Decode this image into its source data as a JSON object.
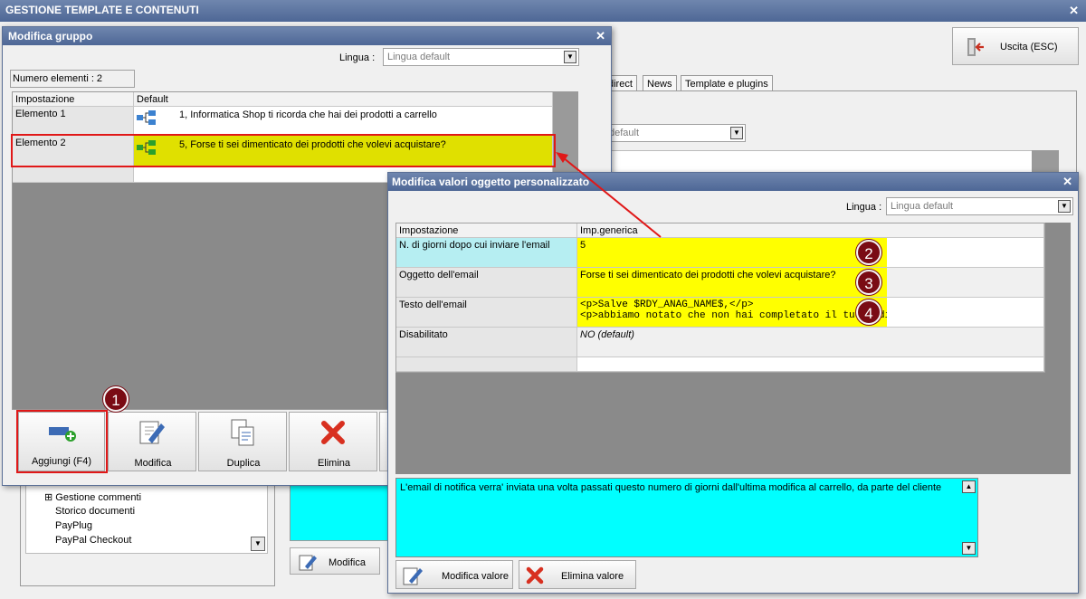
{
  "app": {
    "title": "GESTIONE TEMPLATE E CONTENUTI",
    "exit_label": "Uscita (ESC)"
  },
  "tabs": [
    "direct",
    "News",
    "Template e plugins"
  ],
  "background": {
    "lang_default": "default",
    "tree_items": [
      "Gestione commenti",
      "Storico documenti",
      "PayPlug",
      "PayPal Checkout"
    ],
    "modifica_label": "Modifica"
  },
  "group_window": {
    "title": "Modifica gruppo",
    "lingua_label": "Lingua :",
    "lingua_value": "Lingua default",
    "count_label": "Numero elementi : 2",
    "headers": [
      "Impostazione",
      "Default"
    ],
    "rows": [
      {
        "name": "Elemento 1",
        "value": "1, Informatica Shop ti ricorda che hai dei prodotti a carrello"
      },
      {
        "name": "Elemento 2",
        "value": "5, Forse ti sei dimenticato dei prodotti che volevi acquistare?"
      }
    ],
    "buttons": [
      "Aggiungi (F4)",
      "Modifica",
      "Duplica",
      "Elimina"
    ]
  },
  "values_window": {
    "title": "Modifica valori oggetto personalizzato",
    "lingua_label": "Lingua :",
    "lingua_value": "Lingua default",
    "headers": [
      "Impostazione",
      "Imp.generica"
    ],
    "rows": [
      {
        "name": "N. di giorni dopo cui inviare l'email",
        "value": "5"
      },
      {
        "name": "Oggetto dell'email",
        "value": "Forse ti sei dimenticato dei prodotti che volevi acquistare?"
      },
      {
        "name": "Testo dell'email",
        "value": "<p>Salve $RDY_ANAG_NAME$,</p>",
        "value2": "<p>abbiamo notato che non hai completato il tuo ordine su"
      },
      {
        "name": "Disabilitato",
        "value": "NO (default)"
      }
    ],
    "description": "L'email di notifica verra' inviata una volta passati questo numero di giorni dall'ultima modifica al carrello, da parte del cliente",
    "buttons": [
      "Modifica valore",
      "Elimina valore"
    ]
  },
  "badges": [
    "1",
    "2",
    "3",
    "4"
  ],
  "colors": {
    "highlight_yellow": "#e0e000",
    "bright_yellow": "#ffff00",
    "cyan": "#00ffff",
    "light_cyan": "#b6eef2",
    "red_marker": "#e01818",
    "badge": "#7a0b14"
  }
}
